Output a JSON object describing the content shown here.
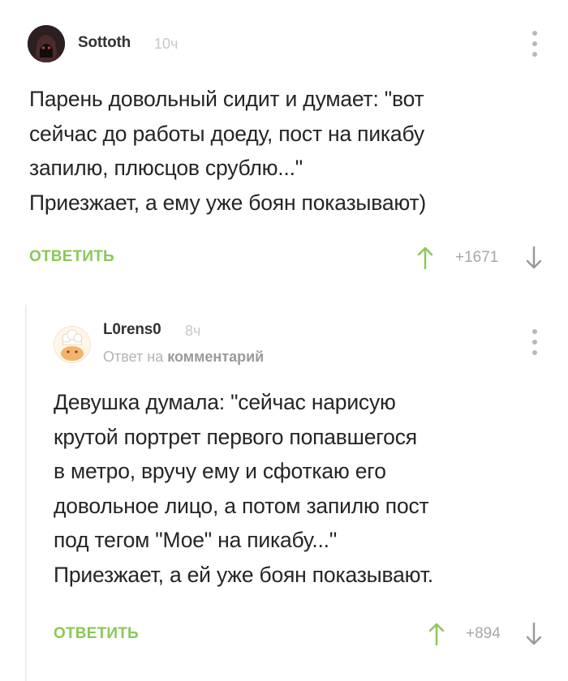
{
  "comments": [
    {
      "username": "Sottoth",
      "time": "10ч",
      "text": "Парень довольный сидит и думает: \"вот\nсейчас до работы доеду, пост на пикабу\nзапилю, плюсцов срублю...\"\nПриезжает, а ему уже боян показывают)",
      "reply_label": "ОТВЕТИТЬ",
      "rating": "+1671"
    },
    {
      "username": "L0rens0",
      "time": "8ч",
      "reply_to_prefix": "Ответ на",
      "reply_to_link": "комментарий",
      "text": "Девушка думала: \"сейчас нарисую\nкрутой портрет первого попавшегося\nв метро, вручу ему и сфоткаю его\nдовольное лицо, а потом запилю пост\nпод тегом \"Мое\" на пикабу...\"\nПриезжает, а ей уже боян показывают.",
      "reply_label": "ОТВЕТИТЬ",
      "rating": "+894"
    }
  ],
  "colors": {
    "accent_green": "#8ac858",
    "muted_gray": "#a7a7a7",
    "text": "#252525"
  },
  "icons": [
    "more-vertical-icon",
    "arrow-up-icon",
    "arrow-down-icon"
  ]
}
